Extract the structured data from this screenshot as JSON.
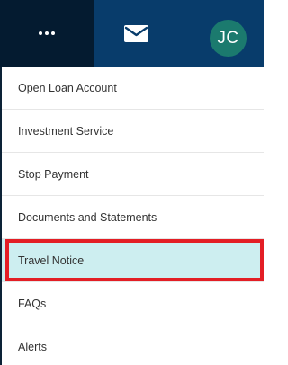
{
  "header": {
    "more_icon": "more-horizontal-icon",
    "mail_icon": "envelope-icon",
    "avatar_initials": "JC"
  },
  "menu": {
    "items": [
      {
        "label": "Open Loan Account"
      },
      {
        "label": "Investment Service"
      },
      {
        "label": "Stop Payment"
      },
      {
        "label": "Documents and Statements"
      },
      {
        "label": "Travel Notice",
        "highlighted": true
      },
      {
        "label": "FAQs"
      },
      {
        "label": "Alerts"
      }
    ]
  },
  "colors": {
    "header_bg": "#083c6b",
    "more_button_bg": "#041b30",
    "avatar_bg": "#1b7a6e",
    "highlight_bg": "#cdeef0",
    "annotation_border": "#e31e25"
  }
}
